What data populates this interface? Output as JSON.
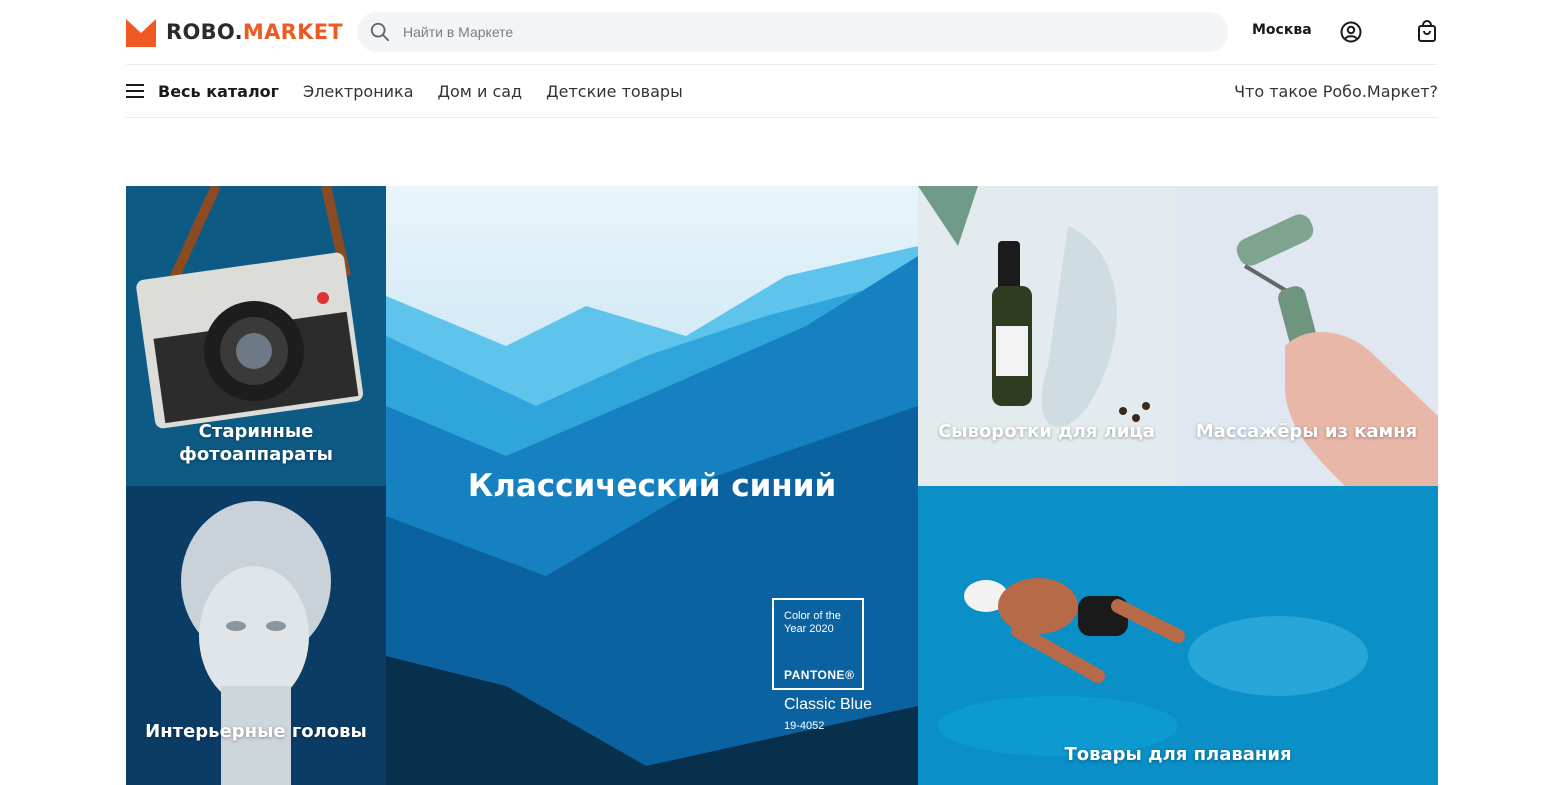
{
  "header": {
    "logo_prefix": "ROBO.",
    "logo_suffix": "MARKET",
    "search_placeholder": "Найти в Маркете",
    "city": "Москва",
    "icons": [
      "search-icon",
      "account-icon",
      "cart-icon"
    ],
    "brand_color": "#f05a22"
  },
  "nav": {
    "catalog_label": "Весь каталог",
    "links": [
      "Электроника",
      "Дом и сад",
      "Детские товары"
    ],
    "about_label": "Что такое Робо.Маркет?"
  },
  "tiles": {
    "camera": "Старинные фотоаппараты",
    "head": "Интерьерные головы",
    "main": "Классический синий",
    "serum": "Сыворотки для лица",
    "massage": "Массажёры из камня",
    "swim": "Товары для плавания"
  },
  "pantone": {
    "small_text": "Color of the Year 2020",
    "brand": "PANTONE®",
    "name": "Classic Blue",
    "code": "19-4052"
  }
}
